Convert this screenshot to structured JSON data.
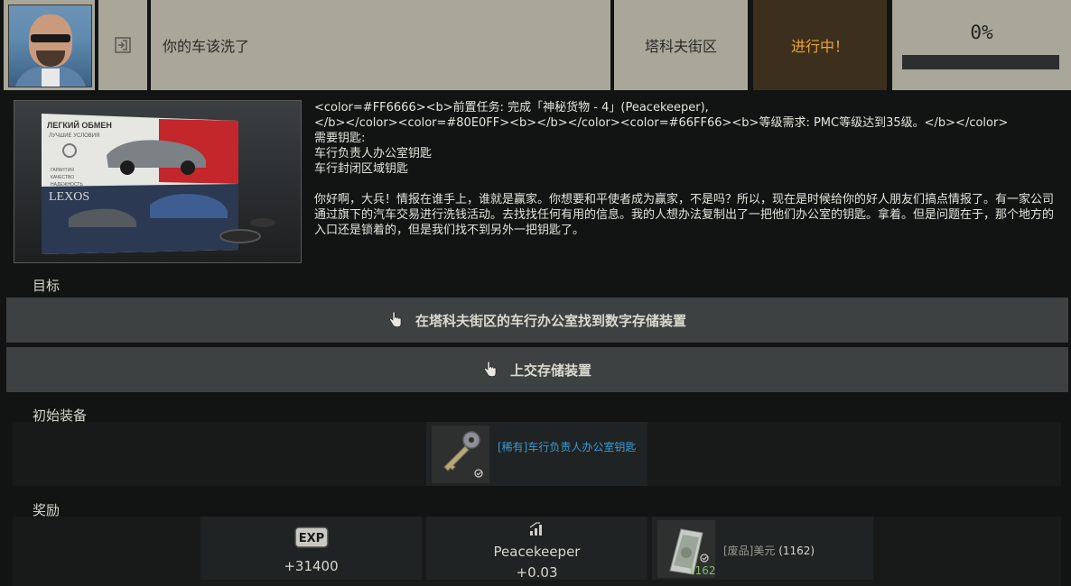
{
  "header": {
    "title": "你的车该洗了",
    "map": "塔科夫街区",
    "status": "进行中！",
    "progress_text": "0%",
    "progress_fraction": 0,
    "status_color": "#e8a43c"
  },
  "description": {
    "line1": "<color=#FF6666><b>前置任务: 完成「神秘货物 - 4」(Peacekeeper),",
    "line2": "</b></color><color=#80E0FF><b></b></color><color=#66FF66><b>等级需求: PMC等级达到35级。</b></color>",
    "line3": "需要钥匙:",
    "line4": "车行负责人办公室钥匙",
    "line5": "车行封闭区域钥匙",
    "body": "你好啊，大兵！情报在谁手上，谁就是赢家。你想要和平使者成为赢家，不是吗？所以，现在是时候给你的好人朋友们搞点情报了。有一家公司通过旗下的汽车交易进行洗钱活动。去找找任何有用的信息。我的人想办法复制出了一把他们办公室的钥匙。拿着。但是问题在于，那个地方的入口还是锁着的，但是我们找不到另外一把钥匙了。"
  },
  "image_texts": {
    "headline1": "ЛЕГКИЙ ОБМЕН",
    "headline2": "ЛУЧШИЕ УСЛОВИЯ",
    "list1": "ГАРАНТИЯ",
    "list2": "КАЧЕСТВО",
    "list3": "НАДЕЖНОСТЬ",
    "brand": "LEXOS"
  },
  "objectives": {
    "label": "目标",
    "items": [
      {
        "text": "在塔科夫街区的车行办公室找到数字存储装置"
      },
      {
        "text": "上交存储装置"
      }
    ]
  },
  "starting_equipment": {
    "label": "初始装备",
    "item_name": "[稀有]车行负责人办公室钥匙",
    "item_color": "#3c9ad6",
    "icon": "key-icon"
  },
  "rewards": {
    "label": "奖励",
    "exp_badge": "EXP",
    "exp_value": "+31400",
    "trader_name": "Peacekeeper",
    "trader_value": "+0.03",
    "money_label": "[废品]美元",
    "money_count": "(1162)",
    "money_stack": "1162"
  }
}
